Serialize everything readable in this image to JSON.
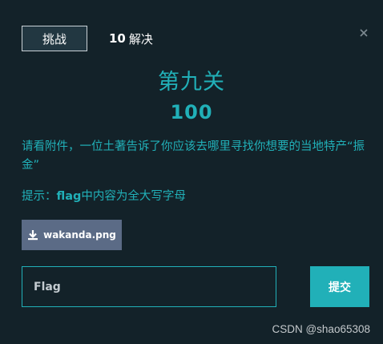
{
  "tabs": {
    "challenge_label": "挑战",
    "solves_count": "10",
    "solves_label": "解决"
  },
  "challenge": {
    "title": "第九关",
    "value": "100",
    "description": "请看附件，一位土著告诉了你应该去哪里寻找你想要的当地特产“振金”",
    "hint_prefix": "提示：",
    "hint_keyword": "flag",
    "hint_suffix": "中内容为全大写字母"
  },
  "file": {
    "name": "wakanda.png",
    "icon": "download-icon"
  },
  "submission": {
    "placeholder": "Flag",
    "submit_label": "提交"
  },
  "watermark": "CSDN @shao65308",
  "colors": {
    "background": "#132229",
    "accent": "#21b0b8",
    "file_button": "#5b6b86"
  }
}
